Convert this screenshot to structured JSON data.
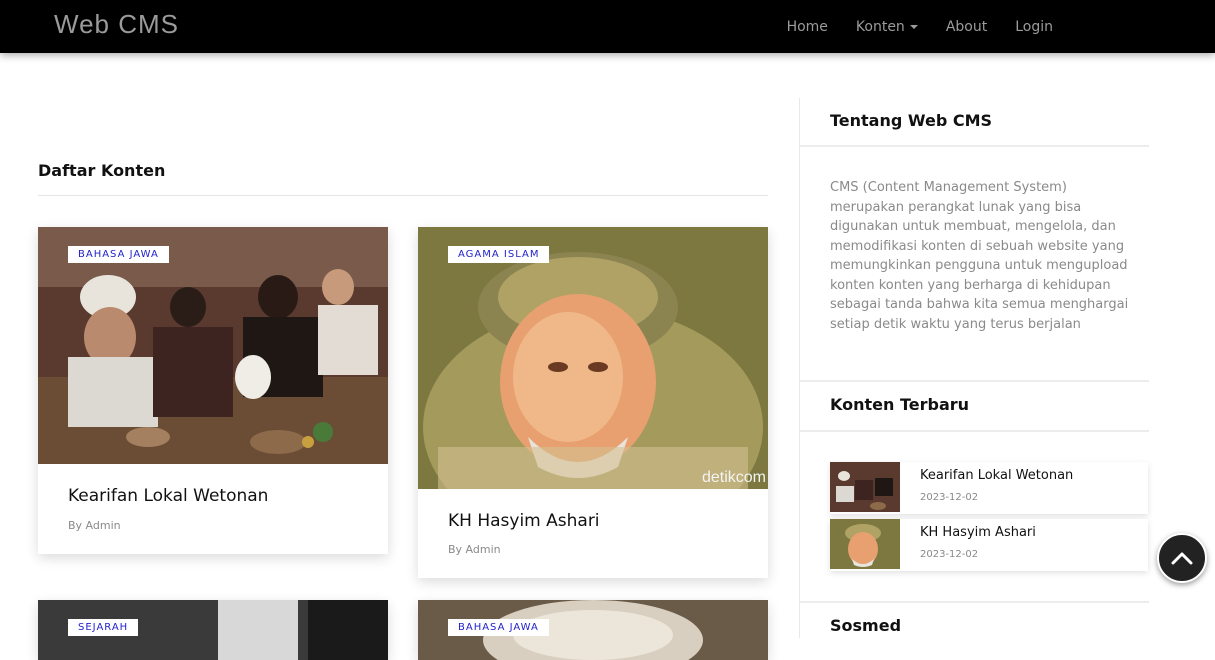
{
  "navbar": {
    "brand": "Web CMS",
    "links": [
      {
        "label": "Home"
      },
      {
        "label": "Konten"
      },
      {
        "label": "About"
      },
      {
        "label": "Login"
      }
    ]
  },
  "main": {
    "title": "Daftar Konten",
    "cards": [
      {
        "badge": "BAHASA JAWA",
        "title": "Kearifan Lokal Wetonan",
        "author": "By Admin"
      },
      {
        "badge": "AGAMA ISLAM",
        "title": "KH Hasyim Ashari",
        "author": "By Admin",
        "watermark": "detikcom"
      },
      {
        "badge": "SEJARAH"
      },
      {
        "badge": "BAHASA JAWA"
      }
    ]
  },
  "sidebar": {
    "about_heading": "Tentang Web CMS",
    "about_text": "CMS (Content Management System) merupakan perangkat lunak yang bisa digunakan untuk membuat, mengelola, dan memodifikasi konten di sebuah website yang memungkinkan pengguna untuk mengupload konten konten yang berharga di kehidupan sebagai tanda bahwa kita semua menghargai setiap detik waktu yang terus berjalan",
    "recent_heading": "Konten Terbaru",
    "recent": [
      {
        "title": "Kearifan Lokal Wetonan",
        "date": "2023-12-02"
      },
      {
        "title": "KH Hasyim Ashari",
        "date": "2023-12-02"
      }
    ],
    "sosmed_heading": "Sosmed"
  },
  "colors": {
    "navbar": "#000000",
    "badge_text": "#2222cc",
    "muted": "#8a8a8a"
  }
}
